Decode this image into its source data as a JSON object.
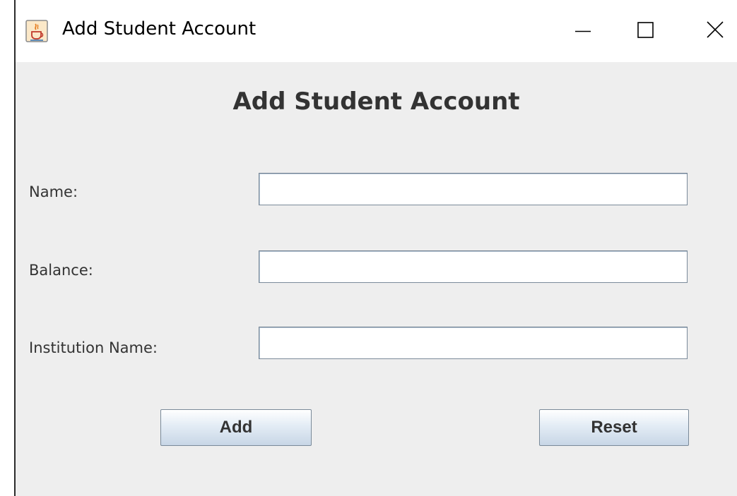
{
  "window": {
    "title": "Add Student Account",
    "icon": "java-cup-icon",
    "controls": [
      "minimize-icon",
      "maximize-icon",
      "close-icon"
    ]
  },
  "form": {
    "heading": "Add Student Account",
    "fields": [
      {
        "label": "Name:",
        "value": ""
      },
      {
        "label": "Balance:",
        "value": ""
      },
      {
        "label": "Institution Name:",
        "value": ""
      }
    ],
    "buttons": {
      "add_label": "Add",
      "reset_label": "Reset"
    }
  },
  "colors": {
    "panel_background": "#eeeeee",
    "text": "#333333",
    "button_gradient_top": "#ffffff",
    "button_gradient_bottom": "#c8d6e6"
  }
}
